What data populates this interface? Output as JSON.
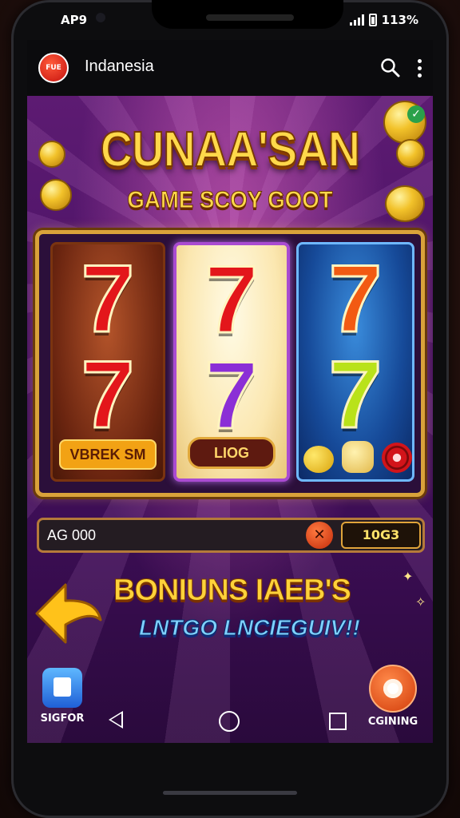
{
  "status_bar": {
    "time": "ΑΡ9",
    "battery": "113%"
  },
  "app_bar": {
    "logo_text": "FUE",
    "title": "Indanesia"
  },
  "game": {
    "title": "CUNAA'SAN",
    "subtitle": "GAME SCOY GOOT",
    "reels": [
      {
        "symbols": [
          "7",
          "7"
        ],
        "label": "VBREK SM"
      },
      {
        "symbols": [
          "7",
          "7"
        ],
        "label": "LIOG"
      },
      {
        "symbols": [
          "7",
          "7"
        ],
        "label": ""
      }
    ],
    "balance": "AG 000",
    "close_symbol": "✕",
    "win_value": "10G3",
    "bonus_title": "BONIUNS IAEB'S",
    "bonus_subtitle": "LNTGO LNCIEGUIV!!",
    "left_button_label": "SIGFOR",
    "right_button_label": "CGINING"
  },
  "colors": {
    "accent_gold": "#ffd84a",
    "background_purple": "#4a1266",
    "reel_red": "#e3161b",
    "reel_purple": "#8b2fd6",
    "reel_lime": "#b9e21a"
  }
}
